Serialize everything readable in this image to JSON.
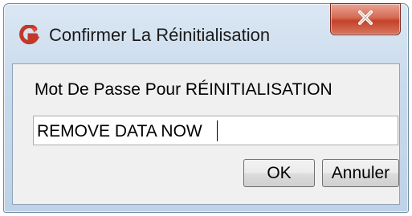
{
  "window": {
    "title": "Confirmer La Réinitialisation",
    "app_icon": "app-logo-icon",
    "close_icon": "close-icon"
  },
  "dialog": {
    "prompt_label": "Mot De Passe Pour RÉINITIALISATION",
    "password_value": "REMOVE DATA NOW",
    "ok_label": "OK",
    "cancel_label": "Annuler"
  },
  "colors": {
    "app_icon_red": "#c0392b",
    "close_button": "#c4412a"
  }
}
